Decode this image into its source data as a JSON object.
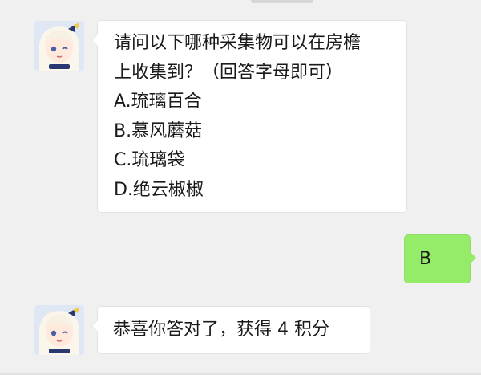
{
  "colors": {
    "background": "#f0f0f0",
    "bubble_received": "#ffffff",
    "bubble_sent": "#95ec69"
  },
  "messages": [
    {
      "direction": "received",
      "avatar_icon": "anime-girl-avatar",
      "lines": [
        "请问以下哪种采集物可以在房檐",
        "上收集到？（回答字母即可）",
        "A.琉璃百合",
        "B.慕风蘑菇",
        "C.琉璃袋",
        "D.绝云椒椒"
      ]
    },
    {
      "direction": "sent",
      "lines": [
        "B"
      ]
    },
    {
      "direction": "received",
      "avatar_icon": "anime-girl-avatar",
      "lines": [
        "恭喜你答对了，获得 4 积分"
      ]
    }
  ]
}
